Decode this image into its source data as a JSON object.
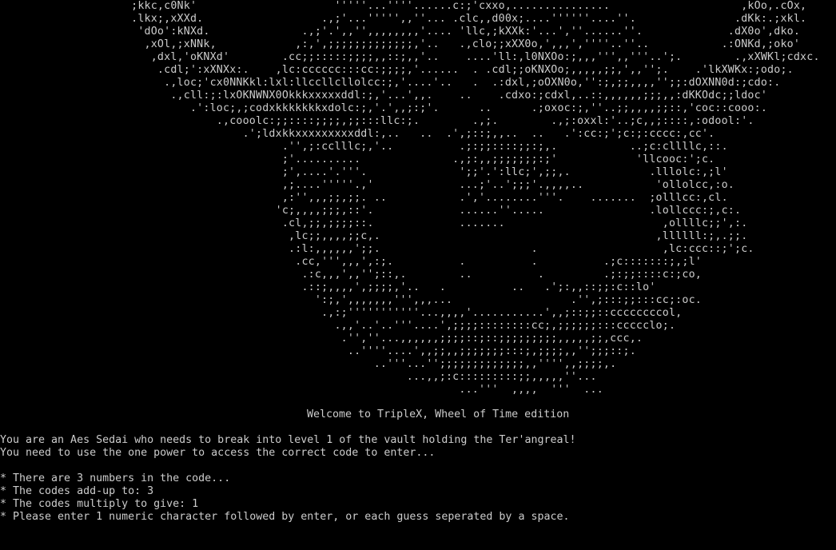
{
  "window": {
    "background": "#000000",
    "text_color": "#cccccc"
  },
  "ascii_art": [
    "                    ;kkc,c0Nk'                     '''''...''''......c:;'cxxo,...............                    ,kOo,.cOx,",
    "                    .lkx;,xXXd.                  .,;'...''''',,''... .clc,,d00x;....''''''....''.               .dKk:.;xkl.",
    "                     'dOo':kNXd.              .,;'.',,'',,,,,,,,'.... 'llc,;kXXk:'...',''......''.             .dX0o',dko.",
    "                      ,xOl,;xNNk,            ,:,',;;;;;;;;;;;;;,'..   .,clo;;xXX0o,',,,',''''..''..           .:ONKd,;oko'",
    "                       ,dxl,'oKNXd'        .cc;;:::::;;;;,,::;,,'..    ....'ll:,l0NXOo:;,,,''',,'''..';.        .,xXWKl;cdxc.",
    "                        .cdl;':xXNXx:.    ,lc:cccccc:::cc:;;;;,'......  . .cdl;;oKNXOo;,,,,,;;,',,'';.    .'lkXWKx:;odo;.",
    "                         .,loc;'cx0NNKkl:lxl:llccllcllolcc:;,'....'..   .  .:dxl,;oOXN0o,'':;,;;,,,,'';;:dOXNN0d:;cdo:.",
    "                          .,cll:;:lxOKNWNX0Okkkxxxxxddl:;,'...',,.    ..    .cdxo:;cdxl,..::,,,,,,;;;,,:dKKOdc;;ldoc'",
    "                             .':loc;,;codxkkkkkkkxdolc:;,'.',,;:;'.      ..      .;oxoc:;,''..;;,,,,;;::,'coc::cooo:.",
    "                                 .,cooolc:;;::::;;;;,;;:::llc:;.        .,;.        .,;:oxxl:'..;c,,;::::,:odool:'.",
    "                                     .';ldxkkxxxxxxxxxddl:,..   ..  .',;::;,,..  ..   .':cc:;';c:;:cccc:,cc'.",
    "                                           .'',;:cclllc;,'..          .;:;;::::;;:;,.           ..;c:cllllc,::.",
    "                                           ;'..........              .,;:,,;;;;;;;:;'            'llcooc:';c.",
    "                                           ;',....'.'''.              ';;'.':llc;',;;,.            .lllolc:,;l'",
    "                                           ,;....'''''.,'             ...;'..';;;'.,,,,..           'ollolcc,:o.",
    "                                           ,:'',,,;;,;;. ..           .','........'''.    .......  ;olllcc:,cl.",
    "                                          'c;,,,,;;;,::'.             ......''.....                .lollccc:;,c:.",
    "                                           .cl,;;,;;;;::.             .......                        ,ollllc;;',:.",
    "                                            ,lc;;,,,,;;c,.                                          ,llllll:;,.;;.",
    "                                            .:l:,,,,,,';;.                       .                   ,lc:ccc::;';c.",
    "                                             .cc,''',,,',:;.          .          .          .;c:::::::;,;l'",
    "                                              .:c,,,',,'';::,.        ..          .         .;:;;::::c:;co,",
    "                                              .::;,,,,',;;;;,'..   .          ..   .';:,,::;;:c::lo'",
    "                                                ':;,',,,,,,,''',,,...                  .'',;:::;;:::cc;:oc.",
    "                                                 .,:;'''''''''''...,,,,'...........',,;::;;::ccccccccol,",
    "                                                   .,,'..'..'''....',;;;;::::::::cc;,;;;;;;:::ccccclo;.",
    "                                                    .'',''...,,,,,,;;;;::;::;;;;;;;;;,,,,,;;,ccc,.",
    "                                                     ..''''....',,;;,,;;;;;;;:::;,;;;;,,'';;;::;.",
    "                                                         ..'''...'';;;;;;;;;;;;;,,'''',,;;;;,.",
    "                                                              ...,,;:c:::::::::;;,,,,,''...",
    "                                                                      ...'''  ,,,,  '''  ..."
  ],
  "welcome_line": "Welcome to TripleX, Wheel of Time edition",
  "story": [
    "You are an Aes Sedai who needs to break into level 1 of the vault holding the Ter'angreal!",
    "You need to use the one power to access the correct code to enter..."
  ],
  "rules": [
    "* There are 3 numbers in the code...",
    "* The codes add-up to: 3",
    "* The codes multiply to give: 1",
    "* Please enter 1 numeric character followed by enter, or each guess seperated by a space."
  ]
}
